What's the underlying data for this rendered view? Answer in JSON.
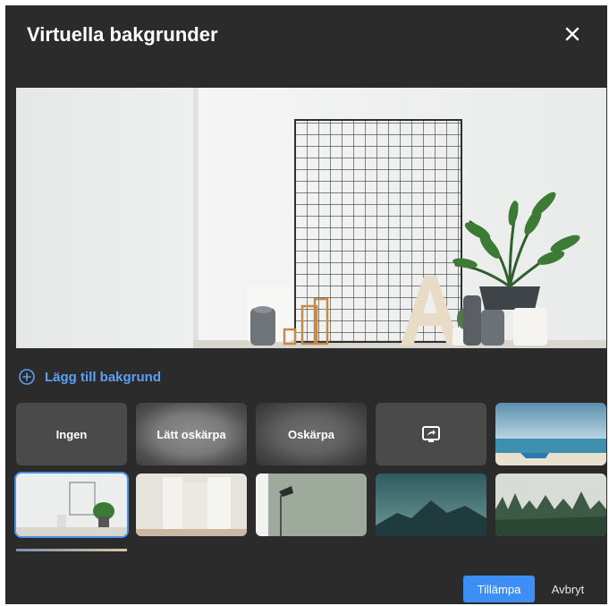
{
  "dialog": {
    "title": "Virtuella bakgrunder",
    "close_icon": "close-icon"
  },
  "add_background": {
    "label": "Lägg till bakgrund",
    "icon": "plus-circle-icon"
  },
  "options": [
    {
      "label": "Ingen"
    },
    {
      "label": "Lätt oskärpa"
    },
    {
      "label": "Oskärpa"
    },
    {
      "icon": "screen-share-icon"
    }
  ],
  "backgrounds": [
    {
      "name": "beach-with-boat"
    },
    {
      "name": "white-room-with-plant",
      "selected": true
    },
    {
      "name": "white-hallway-doors"
    },
    {
      "name": "green-wall-floor-lamp"
    },
    {
      "name": "mountain-landscape"
    },
    {
      "name": "misty-forest"
    },
    {
      "name": "gradient-sky"
    }
  ],
  "footer": {
    "apply_label": "Tillämpa",
    "cancel_label": "Avbryt"
  },
  "colors": {
    "dialog_bg": "#2b2b2b",
    "accent": "#3d8ff5",
    "link": "#5aa0f4"
  }
}
